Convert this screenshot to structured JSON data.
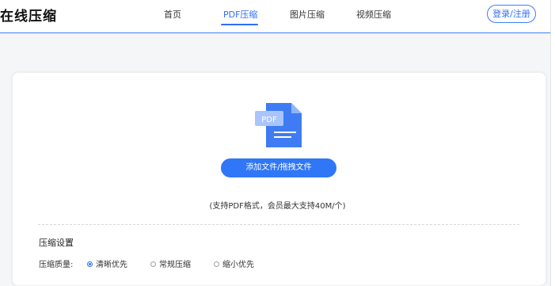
{
  "header": {
    "logo": "在线压缩",
    "nav": [
      {
        "label": "首页",
        "active": false
      },
      {
        "label": "PDF压缩",
        "active": true
      },
      {
        "label": "图片压缩",
        "active": false
      },
      {
        "label": "视频压缩",
        "active": false
      }
    ],
    "login_label": "登录/注册"
  },
  "upload": {
    "icon_text": "PDF",
    "icon_name": "pdf-file-icon",
    "button_label": "添加文件/拖拽文件",
    "support_text": "(支持PDF格式，会员最大支持40M/个)"
  },
  "settings": {
    "title": "压缩设置",
    "quality_label": "压缩质量:",
    "options": [
      {
        "label": "清晰优先",
        "checked": true
      },
      {
        "label": "常规压缩",
        "checked": false
      },
      {
        "label": "缩小优先",
        "checked": false
      }
    ]
  },
  "colors": {
    "accent": "#2f6ff5",
    "button": "#2f77f6",
    "icon_main": "#3f7cf3",
    "icon_tab": "#a9c5fb"
  }
}
